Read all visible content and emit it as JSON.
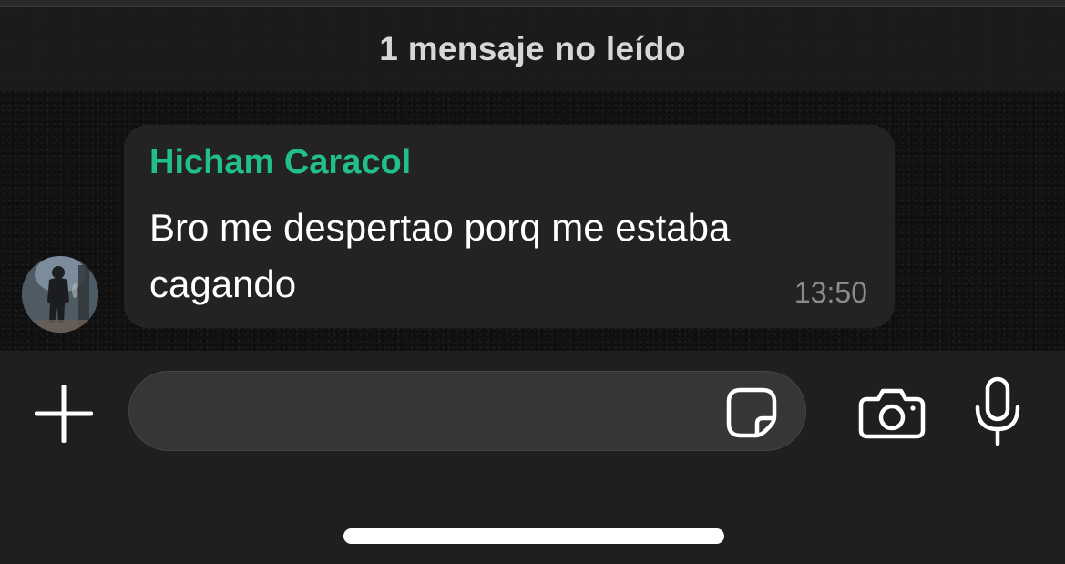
{
  "banner": {
    "unread_label": "1 mensaje no leído"
  },
  "message": {
    "sender": "Hicham Caracol",
    "text": "Bro me despertao porq me estaba cagando",
    "time": "13:50",
    "sender_color": "#21c08b"
  },
  "composer": {
    "placeholder": "",
    "icons": {
      "attach": "plus-icon",
      "sticker": "sticker-icon",
      "camera": "camera-icon",
      "mic": "microphone-icon"
    }
  }
}
